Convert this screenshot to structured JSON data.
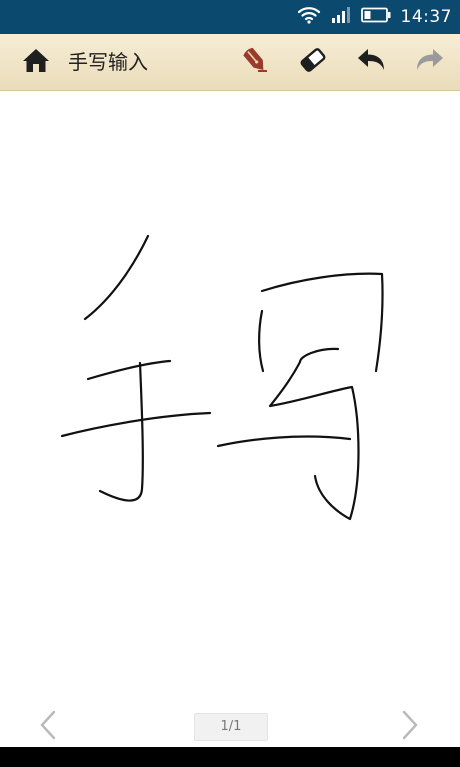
{
  "status_bar": {
    "time": "14:37",
    "icons": [
      "wifi-icon",
      "signal-icon",
      "battery-icon"
    ],
    "background": "#0b4a6e"
  },
  "toolbar": {
    "title": "手写输入",
    "home_icon": "home-icon",
    "pen_icon": "pen-icon",
    "eraser_icon": "eraser-icon",
    "undo_icon": "undo-icon",
    "redo_icon": "redo-icon",
    "pen_color": "#9a3a2a",
    "redo_enabled": false
  },
  "page_nav": {
    "page_label": "1/1",
    "prev_icon": "chevron-left-icon",
    "next_icon": "chevron-right-icon"
  }
}
